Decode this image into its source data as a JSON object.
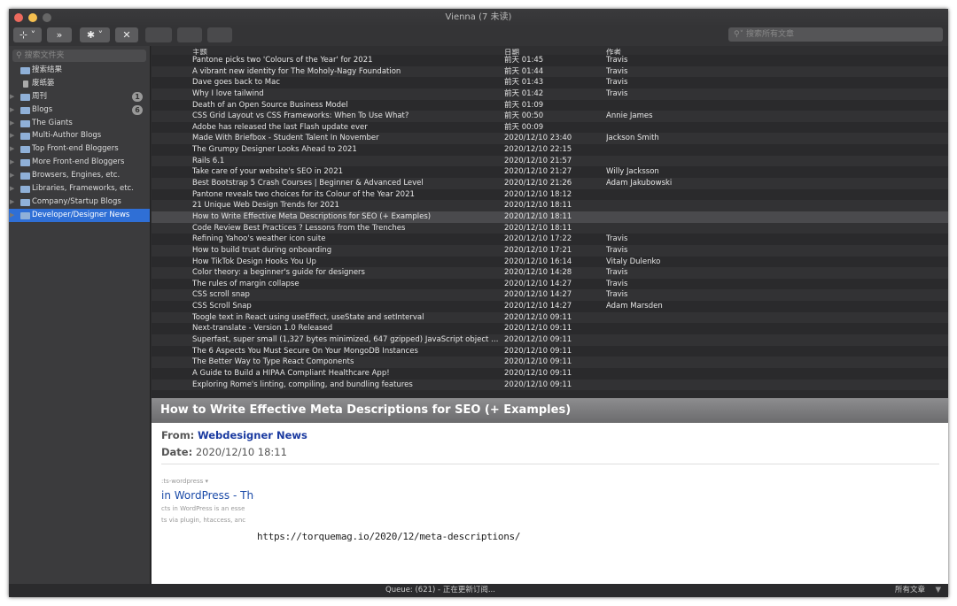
{
  "window": {
    "title": "Vienna (7 未读)"
  },
  "toolbar": {
    "buttons": [
      {
        "name": "subscribe",
        "icon": "rss-plus-icon",
        "label": "⊹ ˅"
      },
      {
        "name": "next-unread",
        "icon": "double-chevron-right-icon",
        "label": "»"
      },
      {
        "name": "action",
        "icon": "gear-icon",
        "label": "✱ ˅"
      },
      {
        "name": "delete",
        "icon": "close-icon",
        "label": "✕"
      },
      {
        "name": "share-twitter",
        "icon": "twitter-icon",
        "label": ""
      },
      {
        "name": "share-facebook",
        "icon": "facebook-icon",
        "label": ""
      },
      {
        "name": "share-buffer",
        "icon": "layers-icon",
        "label": ""
      }
    ],
    "search_placeholder": "搜索所有文章"
  },
  "sidebar": {
    "filter_placeholder": "搜索文件夹",
    "items": [
      {
        "label": "搜索结果",
        "icon": "folder-icon",
        "expandable": false
      },
      {
        "label": "废纸篓",
        "icon": "trash-icon",
        "expandable": false
      },
      {
        "label": "周刊",
        "icon": "folder-icon",
        "expandable": true,
        "badge": "1"
      },
      {
        "label": "Blogs",
        "icon": "folder-icon",
        "expandable": true,
        "badge": "6"
      },
      {
        "label": "The Giants",
        "icon": "folder-icon",
        "expandable": true
      },
      {
        "label": "Multi-Author Blogs",
        "icon": "folder-icon",
        "expandable": true
      },
      {
        "label": "Top Front-end Bloggers",
        "icon": "folder-icon",
        "expandable": true
      },
      {
        "label": "More Front-end Bloggers",
        "icon": "folder-icon",
        "expandable": true
      },
      {
        "label": "Browsers, Engines, etc.",
        "icon": "folder-icon",
        "expandable": true
      },
      {
        "label": "Libraries, Frameworks, etc.",
        "icon": "folder-icon",
        "expandable": true
      },
      {
        "label": "Company/Startup Blogs",
        "icon": "folder-icon",
        "expandable": true
      },
      {
        "label": "Developer/Designer News",
        "icon": "folder-icon",
        "expandable": true,
        "selected": true
      }
    ]
  },
  "list": {
    "columns": [
      "主题",
      "日期",
      "作者"
    ],
    "rows": [
      [
        "Pantone picks two 'Colours of the Year' for 2021",
        "前天 01:45",
        "Travis"
      ],
      [
        "A vibrant new identity for The Moholy-Nagy Foundation",
        "前天 01:44",
        "Travis"
      ],
      [
        "Dave goes back to Mac",
        "前天 01:43",
        "Travis"
      ],
      [
        "Why I love tailwind",
        "前天 01:42",
        "Travis"
      ],
      [
        "Death of an Open Source Business Model",
        "前天 01:09",
        ""
      ],
      [
        "CSS Grid Layout vs CSS Frameworks: When To Use What?",
        "前天 00:50",
        "Annie James"
      ],
      [
        "Adobe has released the last Flash update ever",
        "前天 00:09",
        ""
      ],
      [
        "Made With Briefbox - Student Talent In November",
        "2020/12/10 23:40",
        "Jackson Smith"
      ],
      [
        "The Grumpy Designer Looks Ahead to 2021",
        "2020/12/10 22:15",
        ""
      ],
      [
        "Rails 6.1",
        "2020/12/10 21:57",
        ""
      ],
      [
        "Take care of your website's SEO in 2021",
        "2020/12/10 21:27",
        "Willy Jacksson"
      ],
      [
        "Best Bootstrap 5 Crash Courses | Beginner & Advanced Level",
        "2020/12/10 21:26",
        "Adam Jakubowski"
      ],
      [
        "Pantone reveals two choices for its Colour of the Year 2021",
        "2020/12/10 18:12",
        ""
      ],
      [
        "21 Unique Web Design Trends for 2021",
        "2020/12/10 18:11",
        ""
      ],
      [
        "How to Write Effective Meta Descriptions for SEO (+ Examples)",
        "2020/12/10 18:11",
        ""
      ],
      [
        "Code Review Best Practices ? Lessons from the Trenches",
        "2020/12/10 18:11",
        ""
      ],
      [
        "Refining Yahoo's weather icon suite",
        "2020/12/10 17:22",
        "Travis"
      ],
      [
        "How to build trust during onboarding",
        "2020/12/10 17:21",
        "Travis"
      ],
      [
        "How TikTok Design Hooks You Up",
        "2020/12/10 16:14",
        "Vitaly Dulenko"
      ],
      [
        "Color theory: a beginner's guide for designers",
        "2020/12/10 14:28",
        "Travis"
      ],
      [
        "The rules of margin collapse",
        "2020/12/10 14:27",
        "Travis"
      ],
      [
        "CSS scroll snap",
        "2020/12/10 14:27",
        "Travis"
      ],
      [
        "CSS Scroll Snap",
        "2020/12/10 14:27",
        "Adam Marsden"
      ],
      [
        "Toogle text in React using useEffect, useState and setInterval",
        "2020/12/10 09:11",
        ""
      ],
      [
        "Next-translate - Version 1.0 Released",
        "2020/12/10 09:11",
        ""
      ],
      [
        "Superfast, super small (1,327 bytes minimized, 647 gzipped) JavaScript object deep copy",
        "2020/12/10 09:11",
        ""
      ],
      [
        "The 6 Aspects You Must Secure On Your MongoDB Instances",
        "2020/12/10 09:11",
        ""
      ],
      [
        "The Better Way to Type React Components",
        "2020/12/10 09:11",
        ""
      ],
      [
        "A Guide to Build a HIPAA Compliant Healthcare App!",
        "2020/12/10 09:11",
        ""
      ],
      [
        "Exploring Rome's linting, compiling, and bundling features",
        "2020/12/10 09:11",
        ""
      ]
    ],
    "selected_index": 14
  },
  "article": {
    "title": "How to Write Effective Meta Descriptions for SEO (+ Examples)",
    "from_label": "From:",
    "from": "Webdesigner News",
    "date_label": "Date:",
    "date": "2020/12/10 18:11",
    "snippet": {
      "crumb": ":ts-wordpress ▾",
      "link": "in WordPress - The",
      "line1": "cts in WordPress is an esse",
      "line2": "ts via plugin, htaccess, anc"
    },
    "url": "https://torquemag.io/2020/12/meta-descriptions/"
  },
  "status": {
    "text": "Queue: (621) - 正在更新订阅...",
    "filter": "所有文章"
  },
  "colors": {
    "accent": "#2f6fd6",
    "close": "#ed6a5e",
    "minimize": "#f5bf4f"
  }
}
